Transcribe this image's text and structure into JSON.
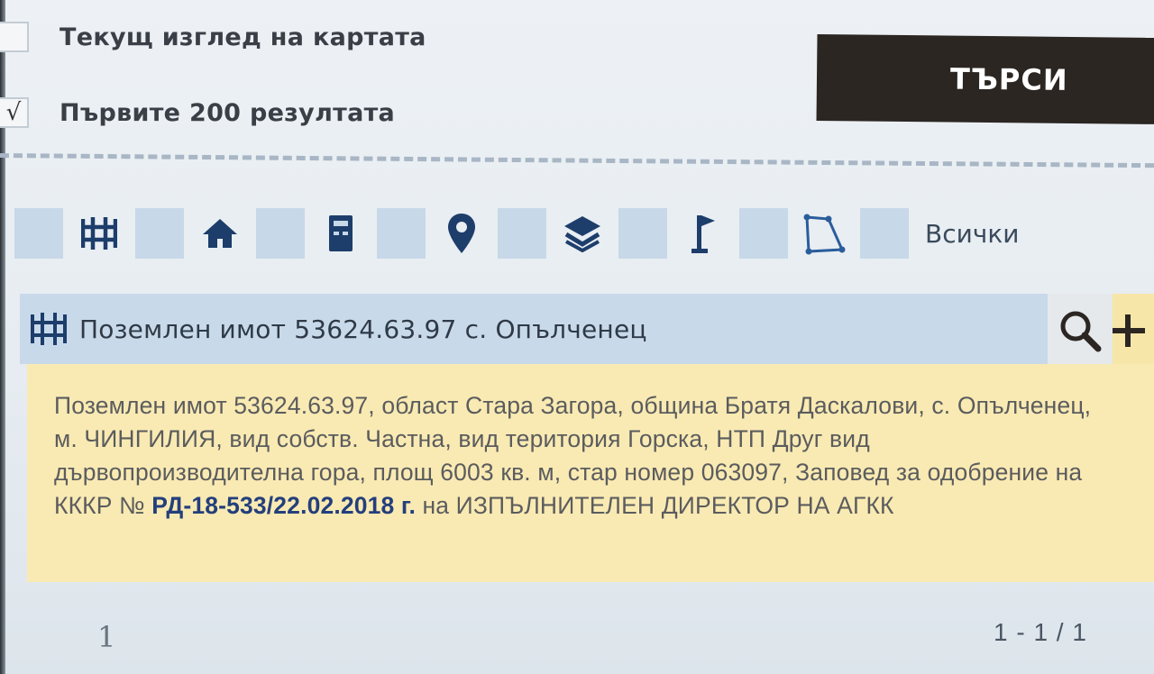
{
  "options": {
    "current_view": {
      "label": "Текущ изглед на картата",
      "checked": false
    },
    "first_200": {
      "label": "Първите 200 резултата",
      "checked": true,
      "mark": "√"
    }
  },
  "search_button": {
    "label": "ТЪРСИ"
  },
  "filters": {
    "items": [
      {
        "icon": "grid-icon"
      },
      {
        "icon": "house-icon"
      },
      {
        "icon": "building-icon"
      },
      {
        "icon": "location-pin-icon"
      },
      {
        "icon": "layers-icon"
      },
      {
        "icon": "flag-icon"
      },
      {
        "icon": "polygon-icon"
      }
    ],
    "all_label": "Всички"
  },
  "result": {
    "title": "Поземлен имот 53624.63.97 с. Опълченец",
    "details_text": "Поземлен имот 53624.63.97, област Стара Загора, община Братя Даскалови, с. Опълченец, м. ЧИНГИЛИЯ, вид собств. Частна, вид територия Горска, НТП Друг вид дървопроизводителна гора, площ 6003 кв. м, стар номер 063097, Заповед за одобрение на КККР №",
    "order_number": "РД-18-533/22.02.2018 г.",
    "details_suffix": "на ИЗПЪЛНИТЕЛЕН ДИРЕКТОР НА АГКК"
  },
  "pager": {
    "page": "1",
    "range": "1 - 1 / 1"
  },
  "colors": {
    "accent_blue": "#1d3d6b",
    "header_bg": "#c8d9ea",
    "details_bg": "#f9eab3",
    "button_bg": "#2c2622"
  }
}
